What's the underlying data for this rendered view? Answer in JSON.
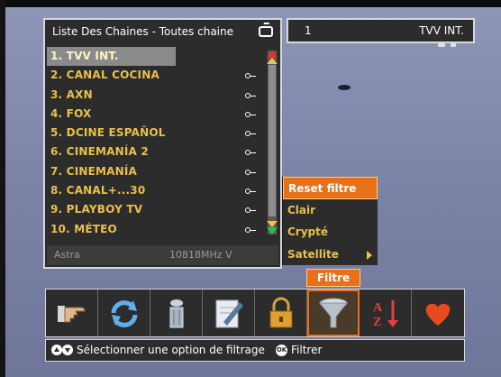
{
  "list": {
    "title": "Liste Des Chaines - Toutes chaine",
    "channels": [
      {
        "label": "1. TVV INT.",
        "locked": false
      },
      {
        "label": "2. CANAL COCINA",
        "locked": true
      },
      {
        "label": "3. AXN",
        "locked": true
      },
      {
        "label": "4. FOX",
        "locked": true
      },
      {
        "label": "5. DCINE ESPAÑOL",
        "locked": true
      },
      {
        "label": "6. CINEMANÍA 2",
        "locked": true
      },
      {
        "label": "7. CINEMANÍA",
        "locked": true
      },
      {
        "label": "8. CANAL+...30",
        "locked": true
      },
      {
        "label": "9. PLAYBOY TV",
        "locked": true
      },
      {
        "label": "10. MÉTEO",
        "locked": true
      }
    ],
    "footer_satellite": "Astra",
    "footer_frequency": "10818MHz V"
  },
  "info": {
    "number": "1",
    "name": "TVV INT."
  },
  "submenu": {
    "items": [
      {
        "label": "Reset filtre"
      },
      {
        "label": "Clair"
      },
      {
        "label": "Crypté"
      },
      {
        "label": "Satellite"
      }
    ]
  },
  "toolbar": {
    "active_label": "Filtre",
    "tools": [
      {
        "icon": "hand-pointer-icon"
      },
      {
        "icon": "refresh-arrows-icon"
      },
      {
        "icon": "trash-bin-icon"
      },
      {
        "icon": "edit-pen-icon"
      },
      {
        "icon": "lock-icon"
      },
      {
        "icon": "funnel-filter-icon"
      },
      {
        "icon": "sort-az-icon"
      },
      {
        "icon": "heart-icon"
      }
    ]
  },
  "status": {
    "select_text": "Sélectionner une option de filtrage",
    "ok_icon": "OK",
    "ok_text": "Filtrer"
  },
  "colors": {
    "accent": "#e8701a",
    "channel_text": "#e8c04a",
    "panel_bg": "#2c2c2c"
  }
}
